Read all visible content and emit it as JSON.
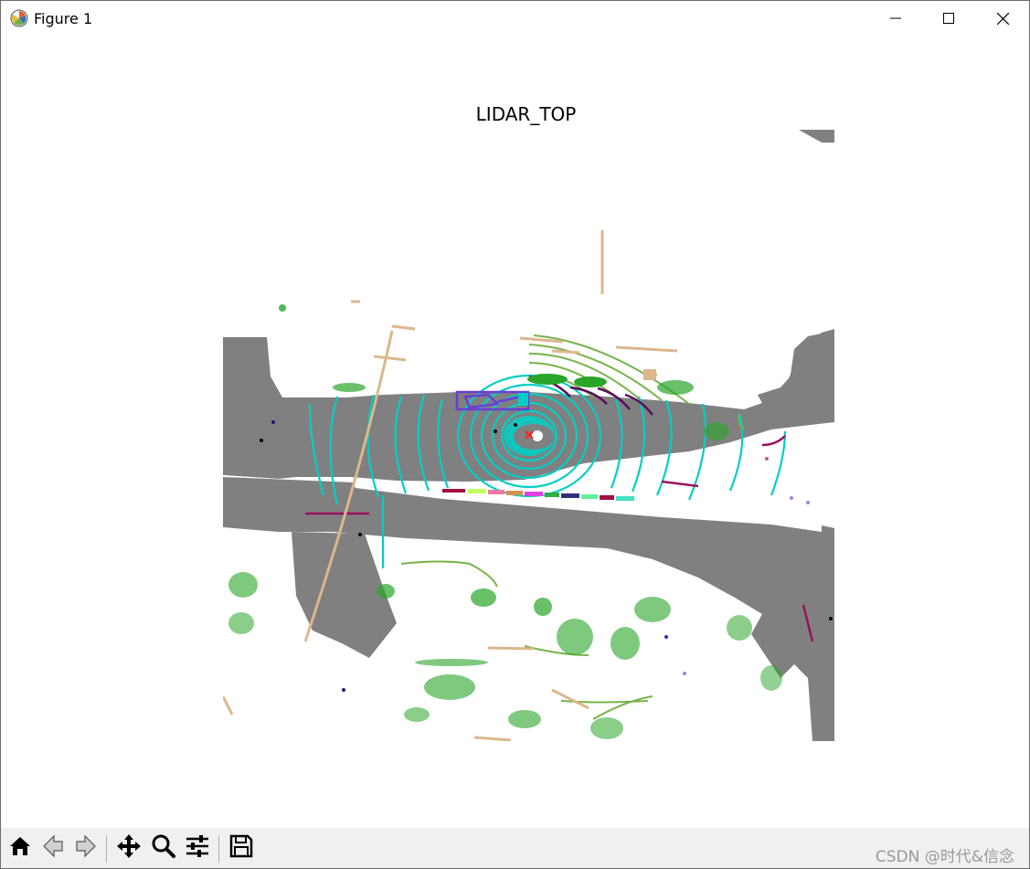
{
  "window": {
    "title": "Figure 1",
    "icons": {
      "app": "matplotlib-icon",
      "minimize": "minimize-icon",
      "maximize": "maximize-icon",
      "close": "close-icon"
    }
  },
  "figure": {
    "axes_title": "LIDAR_TOP",
    "colors": {
      "road": "#808080",
      "background": "#ffffff",
      "near_points": "#00d0c8",
      "vegetation": "#2aa52a",
      "building": "#dcb78c",
      "terrain": "#77b34a",
      "car_box": "#6a3dd6",
      "ego_marker": "#ff2020",
      "barrier": "#9a1060"
    }
  },
  "toolbar": {
    "buttons": [
      {
        "name": "home-button",
        "icon": "home-icon"
      },
      {
        "name": "back-button",
        "icon": "arrow-left-icon"
      },
      {
        "name": "forward-button",
        "icon": "arrow-right-icon"
      },
      {
        "name": "pan-button",
        "icon": "move-icon"
      },
      {
        "name": "zoom-button",
        "icon": "magnifier-icon"
      },
      {
        "name": "configure-subplots-button",
        "icon": "sliders-icon"
      },
      {
        "name": "save-button",
        "icon": "floppy-disk-icon"
      }
    ],
    "watermark": "CSDN @时代&信念"
  }
}
